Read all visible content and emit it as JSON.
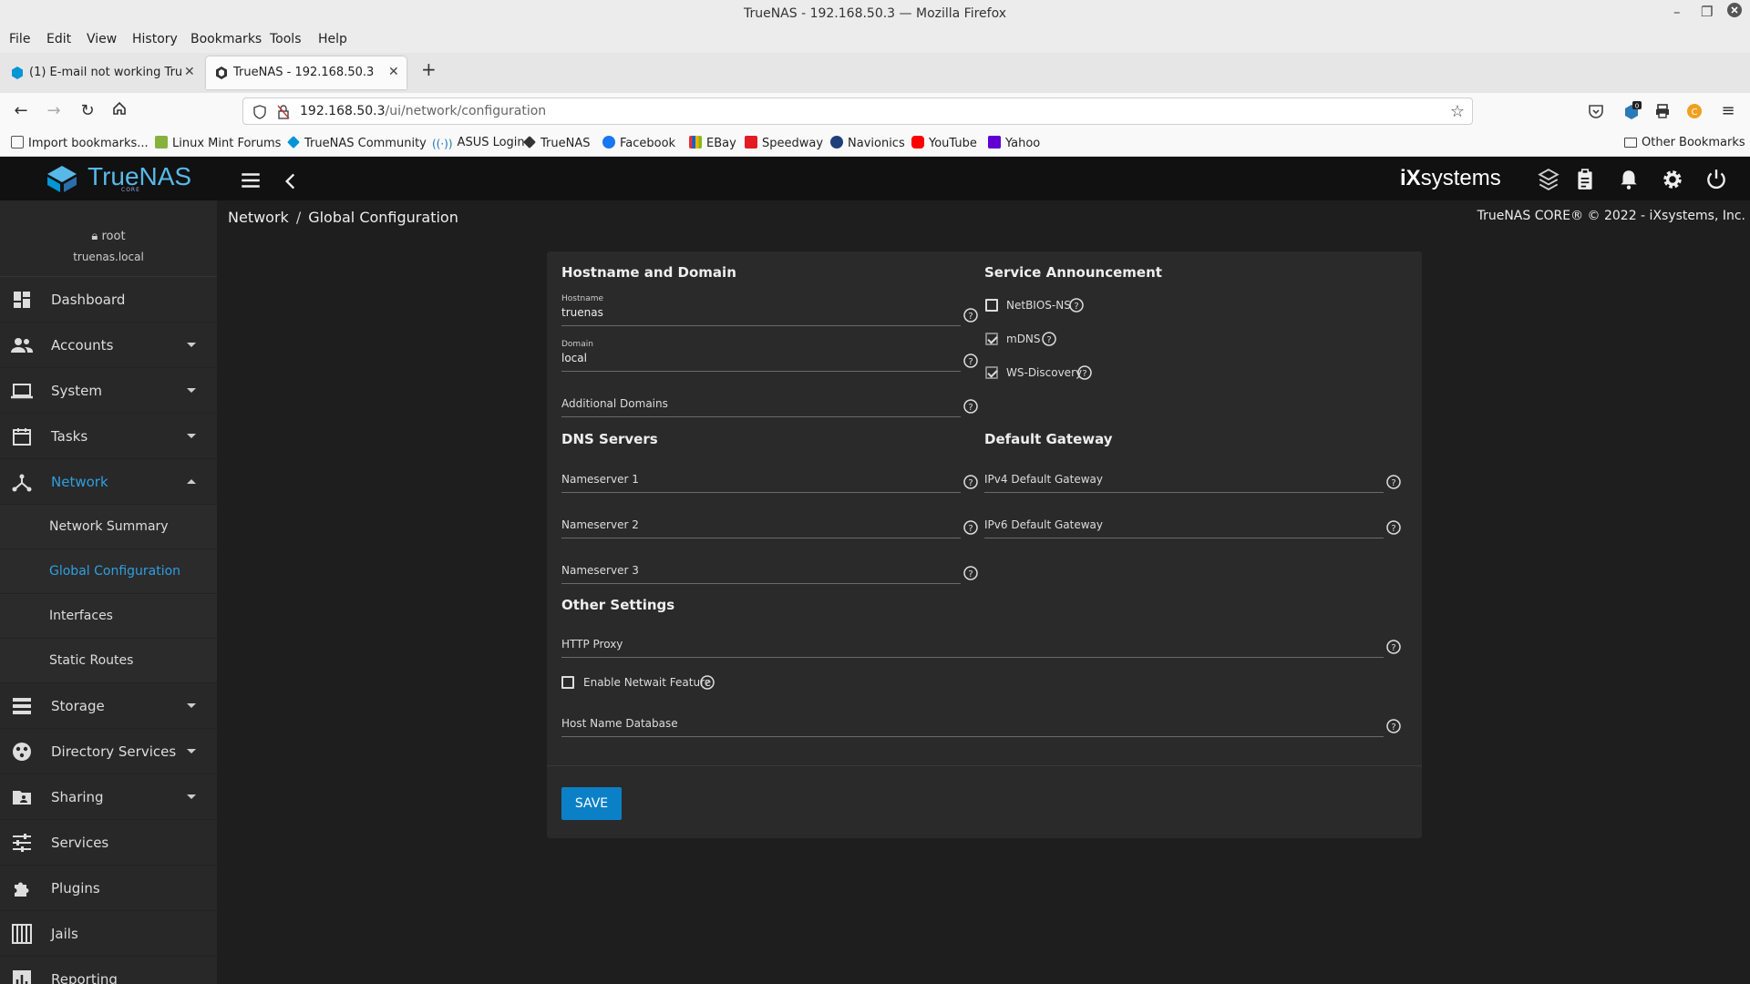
{
  "window": {
    "title": "TrueNAS - 192.168.50.3 — Mozilla Firefox"
  },
  "menu": [
    "File",
    "Edit",
    "View",
    "History",
    "Bookmarks",
    "Tools",
    "Help"
  ],
  "tabs": [
    {
      "label": "(1) E-mail not working TrueNAS",
      "active": false
    },
    {
      "label": "TrueNAS - 192.168.50.3",
      "active": true
    }
  ],
  "address": {
    "host": "192.168.50.3",
    "path": "/ui/network/configuration"
  },
  "bookmarks": [
    {
      "label": "Import bookmarks...",
      "color": "#555555"
    },
    {
      "label": "Linux Mint Forums",
      "color": "#87b13f"
    },
    {
      "label": "TrueNAS Community",
      "color": "#0095d5"
    },
    {
      "label": "ASUS Login",
      "color": "#1a73b8"
    },
    {
      "label": "TrueNAS",
      "color": "#333333"
    },
    {
      "label": "Facebook",
      "color": "#1877f2"
    },
    {
      "label": "EBay",
      "color": "#e53238"
    },
    {
      "label": "Speedway",
      "color": "#e31b23"
    },
    {
      "label": "Navionics",
      "color": "#1f3f7a"
    },
    {
      "label": "YouTube",
      "color": "#ff0000"
    },
    {
      "label": "Yahoo",
      "color": "#6001d2"
    }
  ],
  "other_bookmarks": "Other Bookmarks",
  "app": {
    "logo": "TrueNAS",
    "logo_sub": "CORE",
    "vendor": "iX",
    "vendor_suffix": "systems"
  },
  "user": {
    "name": "root",
    "host": "truenas.local"
  },
  "sidebar": {
    "items": [
      {
        "label": "Dashboard",
        "icon": "dashboard-icon"
      },
      {
        "label": "Accounts",
        "icon": "accounts-icon"
      },
      {
        "label": "System",
        "icon": "system-icon"
      },
      {
        "label": "Tasks",
        "icon": "tasks-icon"
      },
      {
        "label": "Network",
        "icon": "network-icon"
      },
      {
        "label": "Storage",
        "icon": "storage-icon"
      },
      {
        "label": "Directory Services",
        "icon": "directory-icon"
      },
      {
        "label": "Sharing",
        "icon": "sharing-icon"
      },
      {
        "label": "Services",
        "icon": "services-icon"
      },
      {
        "label": "Plugins",
        "icon": "plugins-icon"
      },
      {
        "label": "Jails",
        "icon": "jails-icon"
      },
      {
        "label": "Reporting",
        "icon": "reporting-icon"
      }
    ],
    "network_sub": [
      "Network Summary",
      "Global Configuration",
      "Interfaces",
      "Static Routes"
    ]
  },
  "breadcrumb": {
    "parent": "Network",
    "current": "Global Configuration"
  },
  "copyright": "TrueNAS CORE® © 2022 - iXsystems, Inc.",
  "form": {
    "hostname_section": "Hostname and Domain",
    "hostname_label": "Hostname",
    "hostname_value": "truenas",
    "domain_label": "Domain",
    "domain_value": "local",
    "additional_domains": "Additional Domains",
    "service_section": "Service Announcement",
    "netbios": {
      "label": "NetBIOS-NS",
      "checked": false
    },
    "mdns": {
      "label": "mDNS",
      "checked": true
    },
    "wsd": {
      "label": "WS-Discovery",
      "checked": true
    },
    "dns_section": "DNS Servers",
    "ns1": "Nameserver 1",
    "ns2": "Nameserver 2",
    "ns3": "Nameserver 3",
    "gw_section": "Default Gateway",
    "ipv4_gw": "IPv4 Default Gateway",
    "ipv6_gw": "IPv6 Default Gateway",
    "other_section": "Other Settings",
    "http_proxy": "HTTP Proxy",
    "netwait": {
      "label": "Enable Netwait Feature",
      "checked": false
    },
    "host_db": "Host Name Database",
    "save_label": "SAVE"
  },
  "colors": {
    "accent": "#0c80c6",
    "active_nav": "#2f9fe0",
    "logo": "#57b9e8"
  }
}
